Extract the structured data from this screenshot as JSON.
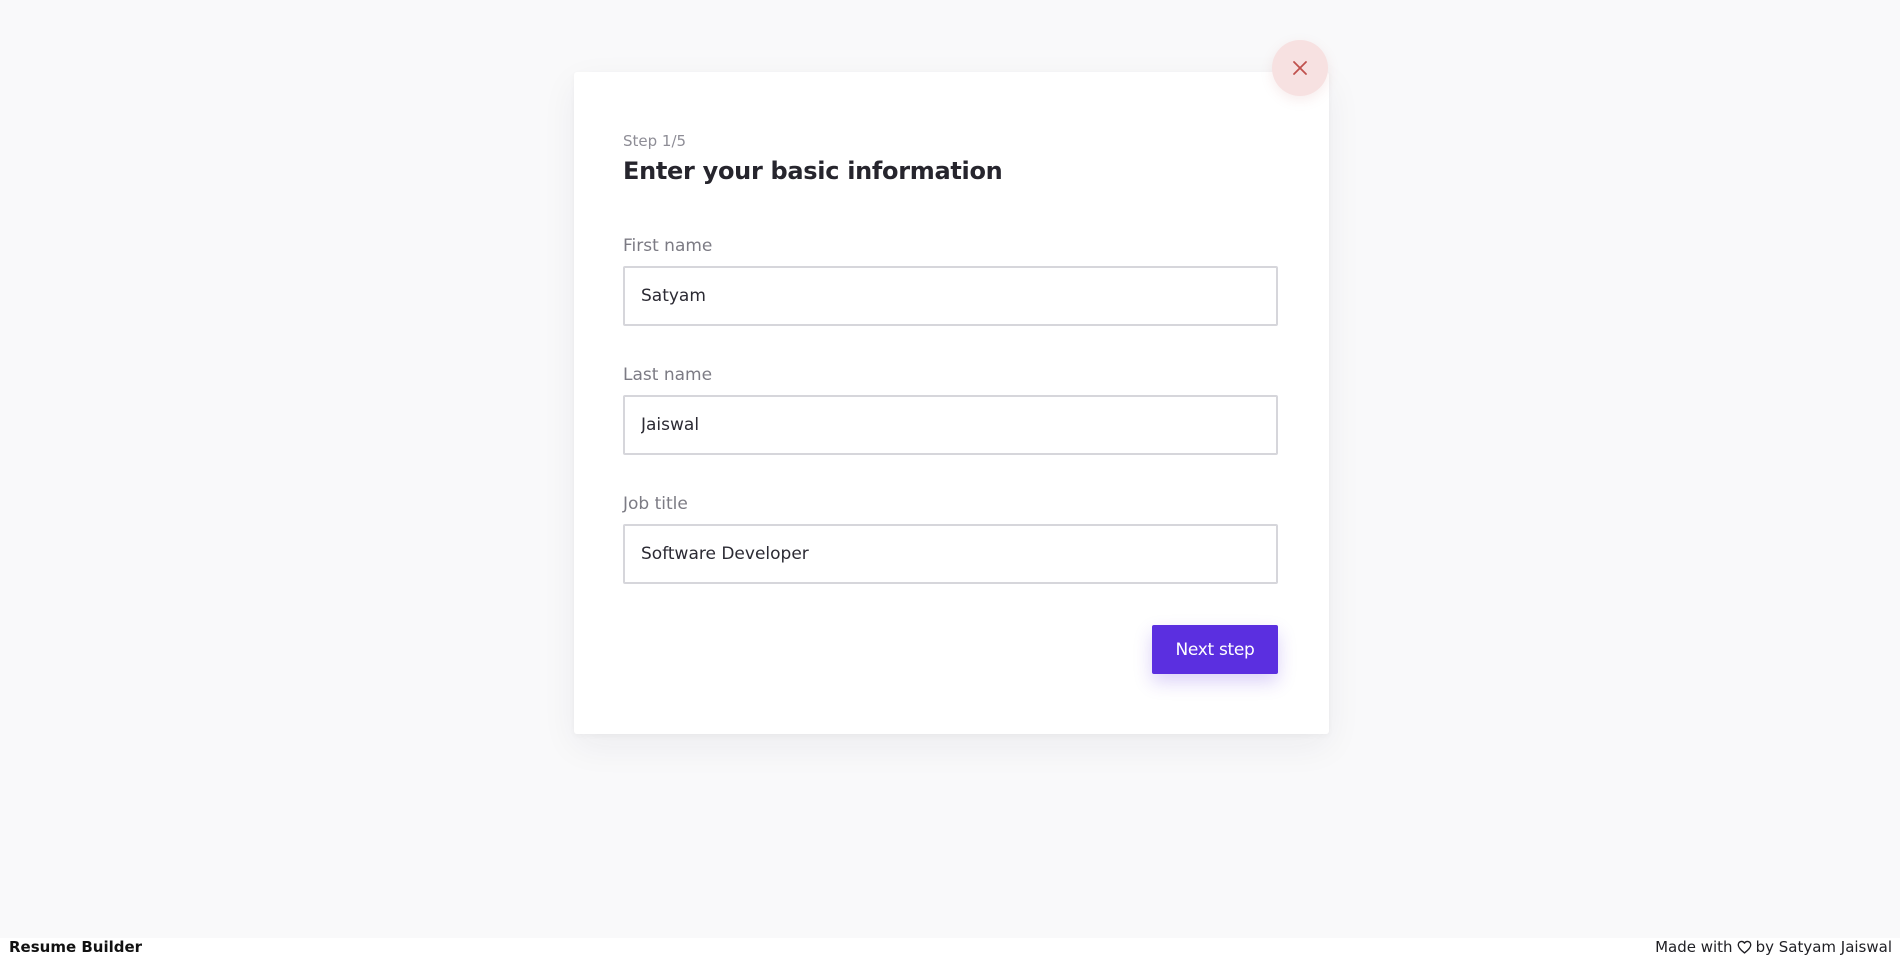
{
  "modal": {
    "step": "Step 1/5",
    "title": "Enter your basic information",
    "close_icon": "close-icon",
    "fields": [
      {
        "label": "First name",
        "value": "Satyam"
      },
      {
        "label": "Last name",
        "value": "Jaiswal"
      },
      {
        "label": "Job title",
        "value": "Software Developer"
      }
    ],
    "next_button": "Next step"
  },
  "footer": {
    "brand": "Resume Builder",
    "credit_prefix": "Made with",
    "heart_icon": "heart-icon",
    "credit_suffix": "by Satyam Jaiswal"
  },
  "colors": {
    "background": "#f9f9fa",
    "primary": "#5b2fe0",
    "close_bg": "#f7e1e1",
    "close_icon": "#c0504d"
  }
}
